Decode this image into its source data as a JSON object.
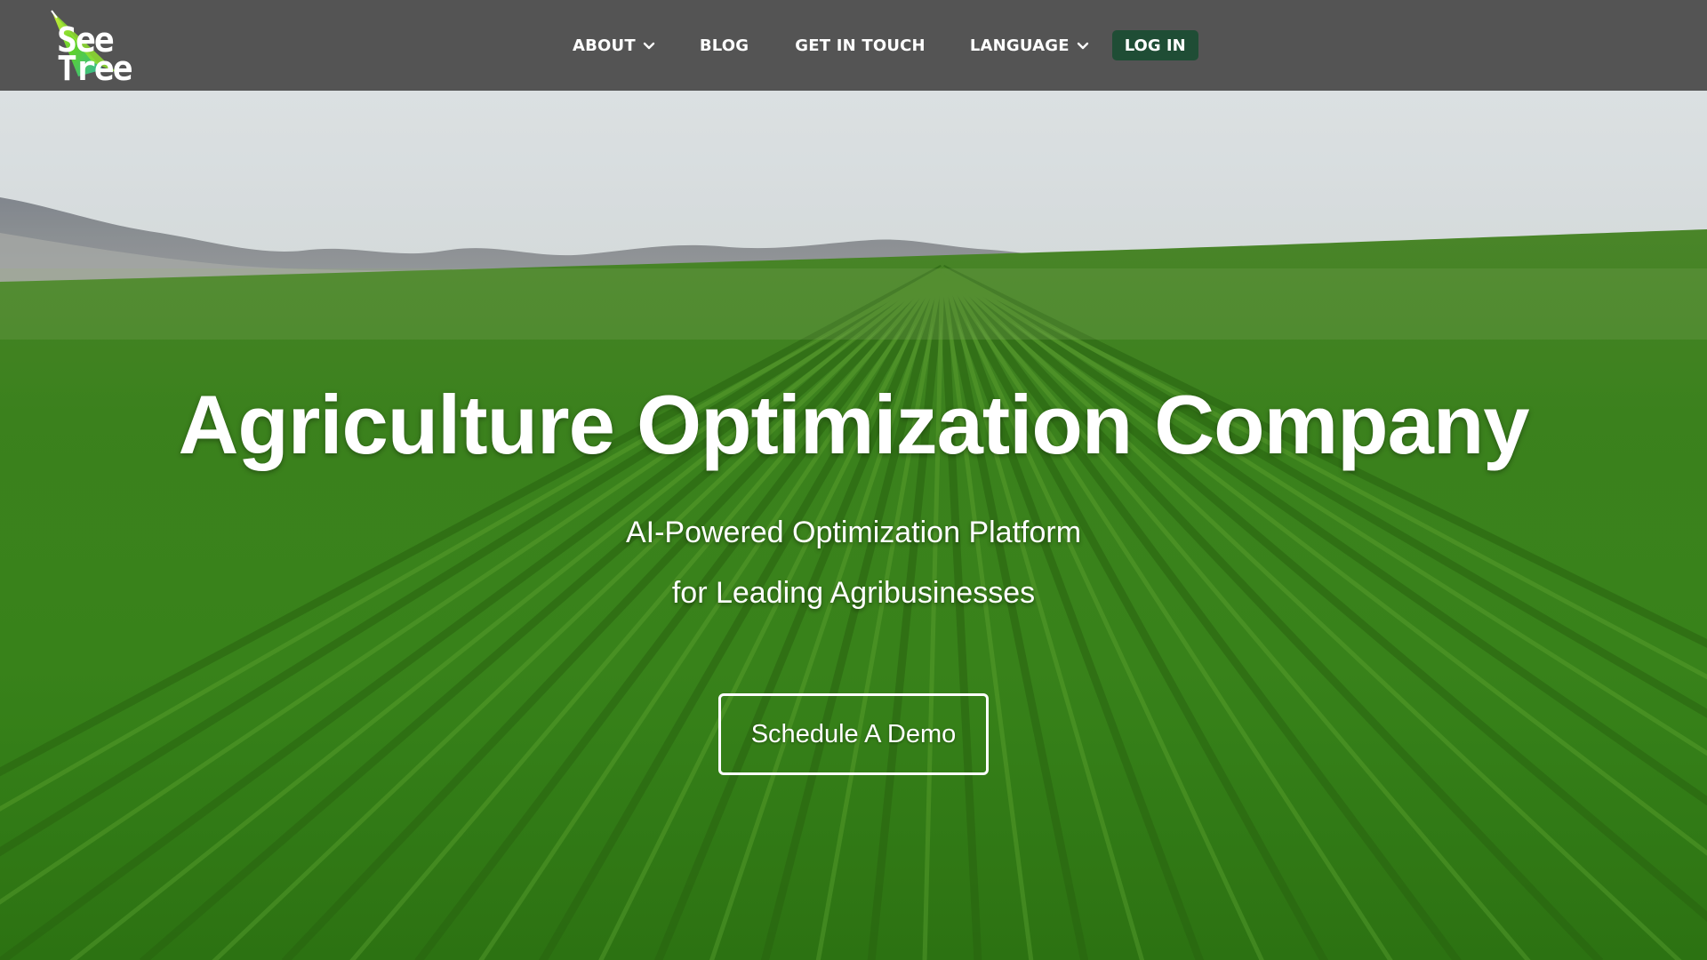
{
  "header": {
    "logo": {
      "line1": "See",
      "line2": "Tree",
      "icon": "seetree-leaf-logo"
    },
    "nav": [
      {
        "label": "ABOUT",
        "dropdown": true
      },
      {
        "label": "BLOG",
        "dropdown": false
      },
      {
        "label": "GET IN TOUCH",
        "dropdown": false
      },
      {
        "label": "LANGUAGE",
        "dropdown": true
      }
    ],
    "login_label": "LOG IN"
  },
  "hero": {
    "title": "Agriculture Optimization Company",
    "subtitle_line1": "AI-Powered Optimization Platform",
    "subtitle_line2": "for Leading Agribusinesses",
    "cta_label": "Schedule A Demo"
  },
  "colors": {
    "header_bg": "#545454",
    "login_bg": "#1f4d35",
    "field_green": "#3f8a1f",
    "sky": "#e6ecef"
  }
}
